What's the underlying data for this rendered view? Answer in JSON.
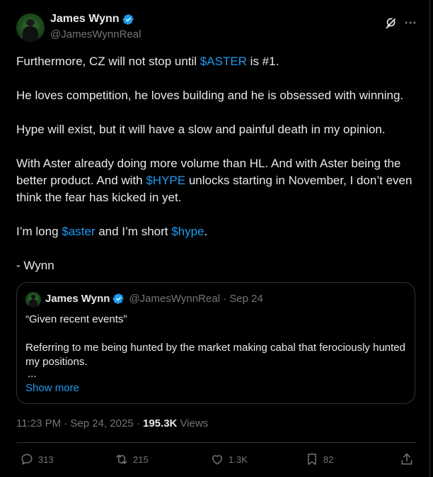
{
  "author": {
    "display_name": "James Wynn",
    "handle": "@JamesWynnReal"
  },
  "post": {
    "p1_pre": "Furthermore, CZ will not stop until ",
    "p1_tag": "$ASTER",
    "p1_post": " is #1.",
    "p2": "He loves competition, he loves building and he is obsessed with winning.",
    "p3": "Hype will exist, but it will have a slow and painful death in my opinion.",
    "p4_pre": "With Aster already doing more volume than HL. And with Aster being the better product. And with ",
    "p4_tag": "$HYPE",
    "p4_post": " unlocks starting in November, I don’t even think the fear has kicked in yet.",
    "p5_pre": "I’m long ",
    "p5_tag1": "$aster",
    "p5_mid": " and I’m short ",
    "p5_tag2": "$hype",
    "p5_post": ".",
    "p6": "- Wynn"
  },
  "quote": {
    "display_name": "James Wynn",
    "meta": "@JamesWynnReal · Sep 24",
    "line1": "“Given recent events”",
    "line2": "Referring to me being hunted by the market making cabal that ferociously hunted my positions.",
    "line3": "...",
    "show_more": "Show more"
  },
  "meta": {
    "timestamp": "11:23 PM · Sep 24, 2025 · ",
    "views_count": "195.3K",
    "views_label": " Views"
  },
  "actions": {
    "replies": "313",
    "reposts": "215",
    "likes": "1.3K",
    "bookmarks": "82"
  },
  "colors": {
    "accent": "#1d9bf0",
    "background": "#000000",
    "text": "#e7e9ea",
    "secondary": "#71767b"
  }
}
